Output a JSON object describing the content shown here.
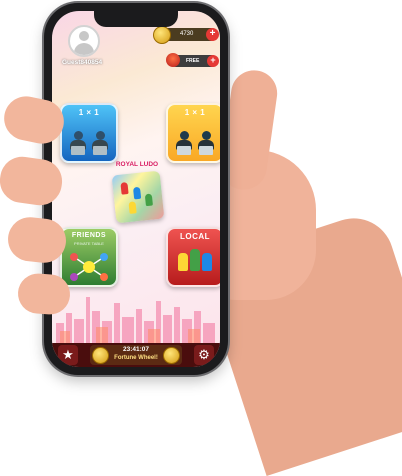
{
  "player": {
    "name": "Guest840854"
  },
  "currency": {
    "coins": "4730",
    "add_symbol": "+"
  },
  "reward": {
    "label": "FREE",
    "add_symbol": "+"
  },
  "modes": [
    {
      "label": "1 × 1"
    },
    {
      "label": "1 × 1"
    },
    {
      "label": "FRIENDS",
      "sublabel": "PRIVATE TABLE"
    },
    {
      "label": "LOCAL"
    }
  ],
  "logo": {
    "text": "ROYAL LUDO"
  },
  "footer": {
    "timer": "23:41:07",
    "wheel_label": "Fortune Wheel!"
  },
  "icons": [
    "avatar-icon",
    "coin-icon",
    "free-gift-icon",
    "star-icon",
    "gear-icon"
  ],
  "colors": {
    "primary_bar": "#4a0d0d",
    "accent": "#e53935",
    "coin": "#f2b52b"
  }
}
